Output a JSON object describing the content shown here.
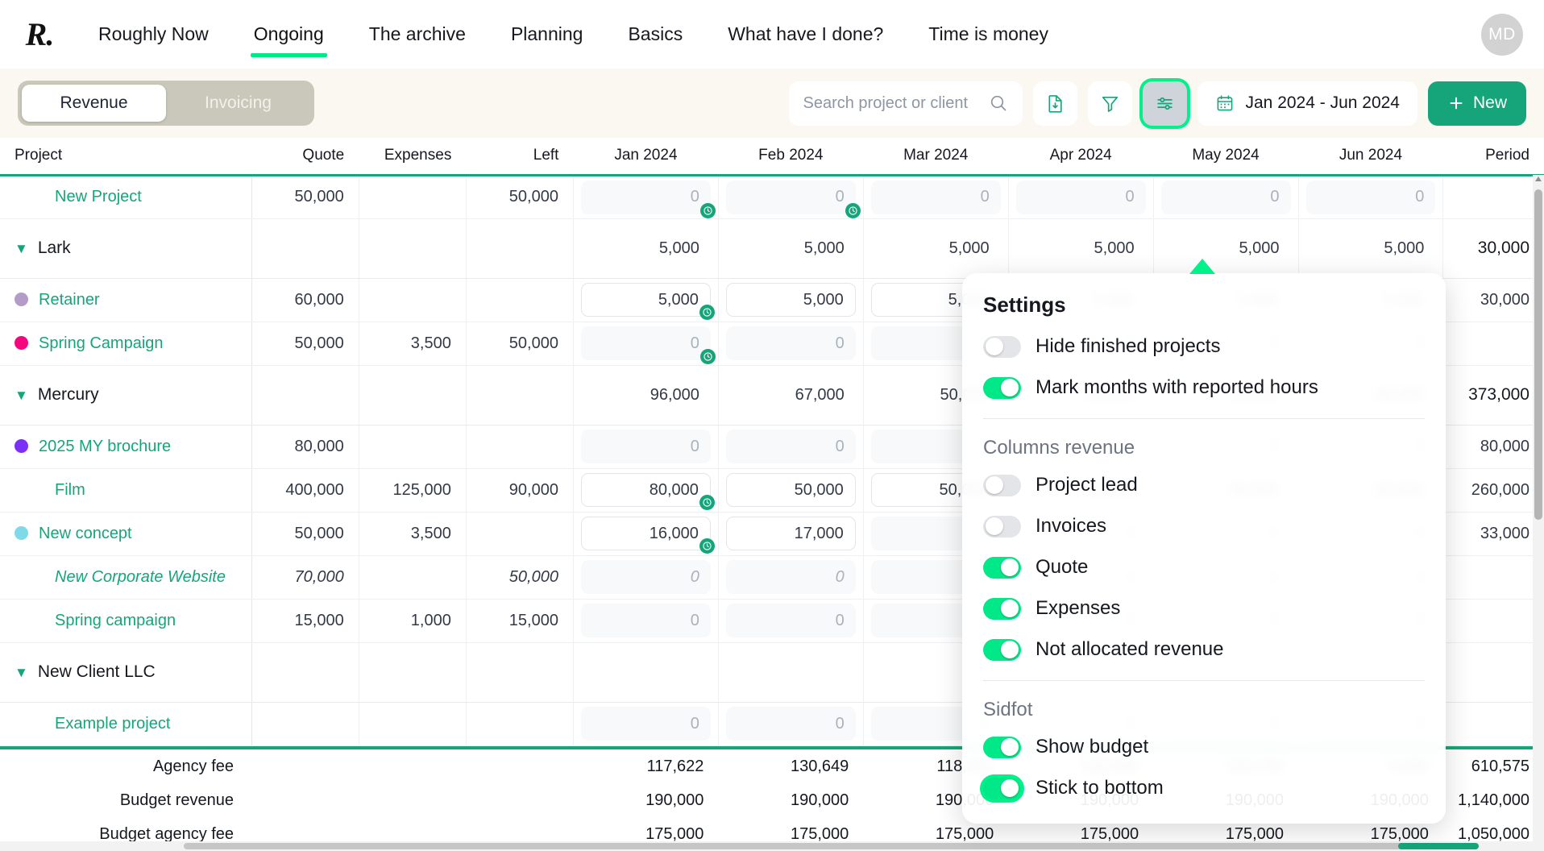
{
  "nav": {
    "logo": "R.",
    "items": [
      {
        "label": "Roughly Now",
        "active": false
      },
      {
        "label": "Ongoing",
        "active": true
      },
      {
        "label": "The archive",
        "active": false
      },
      {
        "label": "Planning",
        "active": false
      },
      {
        "label": "Basics",
        "active": false
      },
      {
        "label": "What have I done?",
        "active": false
      },
      {
        "label": "Time is money",
        "active": false
      }
    ],
    "avatar_initials": "MD"
  },
  "toolbar": {
    "segment_revenue": "Revenue",
    "segment_invoicing": "Invoicing",
    "search_placeholder": "Search project or client",
    "search_value": "",
    "export_icon": "document-download-icon",
    "filter_icon": "funnel-icon",
    "settings_icon": "sliders-icon",
    "calendar_icon": "calendar-icon",
    "date_range": "Jan 2024 - Jun 2024",
    "new_button": "New",
    "accent_green": "#00e887",
    "brand_green": "#16a57a"
  },
  "table": {
    "headers": {
      "project": "Project",
      "quote": "Quote",
      "expenses": "Expenses",
      "left": "Left",
      "months": [
        "Jan 2024",
        "Feb 2024",
        "Mar 2024",
        "Apr 2024",
        "May 2024",
        "Jun 2024"
      ],
      "period": "Period"
    },
    "rows": [
      {
        "type": "project",
        "name": "New Project",
        "dot": null,
        "italic": false,
        "indent": 1,
        "quote": "50,000",
        "expenses": "",
        "left": "50,000",
        "months": [
          {
            "value": "0",
            "style": "muted",
            "clock": true
          },
          {
            "value": "0",
            "style": "muted",
            "clock": true
          },
          {
            "value": "0",
            "style": "muted",
            "clock": false
          },
          {
            "value": "0",
            "style": "muted",
            "clock": false
          },
          {
            "value": "0",
            "style": "muted",
            "clock": false
          },
          {
            "value": "0",
            "style": "muted",
            "clock": false
          }
        ],
        "period": ""
      },
      {
        "type": "group",
        "name": "Lark",
        "dot": null,
        "italic": false,
        "indent": 0,
        "quote": "",
        "expenses": "",
        "left": "",
        "months": [
          {
            "value": "5,000",
            "style": "plain",
            "clock": false
          },
          {
            "value": "5,000",
            "style": "plain",
            "clock": false
          },
          {
            "value": "5,000",
            "style": "plain",
            "clock": false
          },
          {
            "value": "5,000",
            "style": "plain",
            "clock": false
          },
          {
            "value": "5,000",
            "style": "plain",
            "clock": false
          },
          {
            "value": "5,000",
            "style": "plain",
            "clock": false
          }
        ],
        "period": "30,000"
      },
      {
        "type": "project",
        "name": "Retainer",
        "dot": "#b49bc8",
        "italic": false,
        "indent": 1,
        "quote": "60,000",
        "expenses": "",
        "left": "",
        "months": [
          {
            "value": "5,000",
            "style": "inputbox",
            "clock": true
          },
          {
            "value": "5,000",
            "style": "inputbox",
            "clock": false
          },
          {
            "value": "5,000",
            "style": "inputbox",
            "clock": false
          },
          {
            "value": "5,000",
            "style": "inputbox",
            "clock": false
          },
          {
            "value": "5,000",
            "style": "inputbox",
            "clock": false
          },
          {
            "value": "5,000",
            "style": "inputbox",
            "clock": false
          }
        ],
        "period": "30,000"
      },
      {
        "type": "project",
        "name": "Spring Campaign",
        "dot": "#f5067f",
        "italic": false,
        "indent": 1,
        "quote": "50,000",
        "expenses": "3,500",
        "left": "50,000",
        "months": [
          {
            "value": "0",
            "style": "muted",
            "clock": true
          },
          {
            "value": "0",
            "style": "muted",
            "clock": false
          },
          {
            "value": "0",
            "style": "muted",
            "clock": false
          },
          {
            "value": "0",
            "style": "muted",
            "clock": false
          },
          {
            "value": "0",
            "style": "muted",
            "clock": false
          },
          {
            "value": "0",
            "style": "muted",
            "clock": false
          }
        ],
        "period": ""
      },
      {
        "type": "group",
        "name": "Mercury",
        "dot": null,
        "italic": false,
        "indent": 0,
        "quote": "",
        "expenses": "",
        "left": "",
        "months": [
          {
            "value": "96,000",
            "style": "plain",
            "clock": false
          },
          {
            "value": "67,000",
            "style": "plain",
            "clock": false
          },
          {
            "value": "50,000",
            "style": "plain",
            "clock": false
          },
          {
            "value": "50,000",
            "style": "plain",
            "clock": false
          },
          {
            "value": "50,000",
            "style": "plain",
            "clock": false
          },
          {
            "value": "60,000",
            "style": "plain",
            "clock": false
          }
        ],
        "period": "373,000"
      },
      {
        "type": "project",
        "name": "2025 MY brochure",
        "dot": "#7b2ff7",
        "italic": false,
        "indent": 1,
        "quote": "80,000",
        "expenses": "",
        "left": "",
        "months": [
          {
            "value": "0",
            "style": "muted",
            "clock": false
          },
          {
            "value": "0",
            "style": "muted",
            "clock": false
          },
          {
            "value": "0",
            "style": "muted",
            "clock": false
          },
          {
            "value": "0",
            "style": "muted",
            "clock": false
          },
          {
            "value": "0",
            "style": "muted",
            "clock": false
          },
          {
            "value": "0",
            "style": "muted",
            "clock": false
          }
        ],
        "period": "80,000"
      },
      {
        "type": "project",
        "name": "Film",
        "dot": null,
        "italic": false,
        "indent": 1,
        "quote": "400,000",
        "expenses": "125,000",
        "left": "90,000",
        "months": [
          {
            "value": "80,000",
            "style": "inputbox",
            "clock": true
          },
          {
            "value": "50,000",
            "style": "inputbox",
            "clock": false
          },
          {
            "value": "50,000",
            "style": "inputbox",
            "clock": false
          },
          {
            "value": "50,000",
            "style": "inputbox",
            "clock": false
          },
          {
            "value": "50,000",
            "style": "inputbox",
            "clock": false
          },
          {
            "value": "50,000",
            "style": "inputbox",
            "clock": false
          }
        ],
        "period": "260,000"
      },
      {
        "type": "project",
        "name": "New concept",
        "dot": "#7fd9e8",
        "italic": false,
        "indent": 1,
        "quote": "50,000",
        "expenses": "3,500",
        "left": "",
        "months": [
          {
            "value": "16,000",
            "style": "inputbox",
            "clock": true
          },
          {
            "value": "17,000",
            "style": "inputbox",
            "clock": false
          },
          {
            "value": "0",
            "style": "muted",
            "clock": false
          },
          {
            "value": "0",
            "style": "muted",
            "clock": false
          },
          {
            "value": "0",
            "style": "muted",
            "clock": false
          },
          {
            "value": "0",
            "style": "muted",
            "clock": false
          }
        ],
        "period": "33,000"
      },
      {
        "type": "project",
        "name": "New Corporate Website",
        "dot": null,
        "italic": true,
        "indent": 1,
        "quote": "70,000",
        "expenses": "",
        "left": "50,000",
        "months": [
          {
            "value": "0",
            "style": "muted",
            "clock": false
          },
          {
            "value": "0",
            "style": "muted",
            "clock": false
          },
          {
            "value": "0",
            "style": "muted",
            "clock": false
          },
          {
            "value": "0",
            "style": "muted",
            "clock": false
          },
          {
            "value": "0",
            "style": "muted",
            "clock": false
          },
          {
            "value": "0",
            "style": "muted",
            "clock": false
          }
        ],
        "period": ""
      },
      {
        "type": "project",
        "name": "Spring campaign",
        "dot": null,
        "italic": false,
        "indent": 1,
        "quote": "15,000",
        "expenses": "1,000",
        "left": "15,000",
        "months": [
          {
            "value": "0",
            "style": "muted",
            "clock": false
          },
          {
            "value": "0",
            "style": "muted",
            "clock": false
          },
          {
            "value": "0",
            "style": "muted",
            "clock": false
          },
          {
            "value": "0",
            "style": "muted",
            "clock": false
          },
          {
            "value": "0",
            "style": "muted",
            "clock": false
          },
          {
            "value": "0",
            "style": "muted",
            "clock": false
          }
        ],
        "period": ""
      },
      {
        "type": "group",
        "name": "New Client LLC",
        "dot": null,
        "italic": false,
        "indent": 0,
        "quote": "",
        "expenses": "",
        "left": "",
        "months": [
          {
            "value": "",
            "style": "plain",
            "clock": false
          },
          {
            "value": "",
            "style": "plain",
            "clock": false
          },
          {
            "value": "",
            "style": "plain",
            "clock": false
          },
          {
            "value": "",
            "style": "plain",
            "clock": false
          },
          {
            "value": "",
            "style": "plain",
            "clock": false
          },
          {
            "value": "",
            "style": "plain",
            "clock": false
          }
        ],
        "period": ""
      },
      {
        "type": "project",
        "name": "Example project",
        "dot": null,
        "italic": false,
        "indent": 1,
        "quote": "",
        "expenses": "",
        "left": "",
        "months": [
          {
            "value": "0",
            "style": "muted",
            "clock": false
          },
          {
            "value": "0",
            "style": "muted",
            "clock": false
          },
          {
            "value": "0",
            "style": "muted",
            "clock": false
          },
          {
            "value": "0",
            "style": "muted",
            "clock": false
          },
          {
            "value": "0",
            "style": "muted",
            "clock": false
          },
          {
            "value": "0",
            "style": "muted",
            "clock": false
          }
        ],
        "period": ""
      }
    ]
  },
  "footer": {
    "rows": [
      {
        "label": "Agency fee",
        "months": [
          "117,622",
          "130,649",
          "118,261",
          "138,300",
          "100,744",
          "5,000"
        ],
        "total": "610,575"
      },
      {
        "label": "Budget revenue",
        "months": [
          "190,000",
          "190,000",
          "190,000",
          "190,000",
          "190,000",
          "190,000"
        ],
        "total": "1,140,000"
      },
      {
        "label": "Budget agency fee",
        "months": [
          "175,000",
          "175,000",
          "175,000",
          "175,000",
          "175,000",
          "175,000"
        ],
        "total": "1,050,000"
      }
    ]
  },
  "settings_panel": {
    "title": "Settings",
    "general": [
      {
        "label": "Hide finished projects",
        "on": false,
        "ring": false
      },
      {
        "label": "Mark months with reported hours",
        "on": true,
        "ring": false
      }
    ],
    "columns_section_title": "Columns revenue",
    "columns": [
      {
        "label": "Project lead",
        "on": false,
        "ring": false
      },
      {
        "label": "Invoices",
        "on": false,
        "ring": false
      },
      {
        "label": "Quote",
        "on": true,
        "ring": false
      },
      {
        "label": "Expenses",
        "on": true,
        "ring": false
      },
      {
        "label": "Not allocated revenue",
        "on": true,
        "ring": false
      }
    ],
    "footer_section_title": "Sidfot",
    "footer_options": [
      {
        "label": "Show budget",
        "on": true,
        "ring": false
      },
      {
        "label": "Stick to bottom",
        "on": true,
        "ring": true
      }
    ]
  }
}
